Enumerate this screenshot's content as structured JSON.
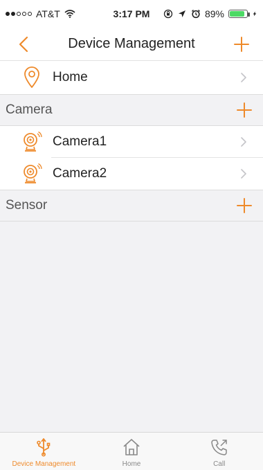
{
  "statusbar": {
    "carrier": "AT&T",
    "time": "3:17 PM",
    "battery": "89%",
    "battery_level": 0.89
  },
  "navbar": {
    "title": "Device Management"
  },
  "home_row": {
    "label": "Home",
    "icon": "location-pin-icon"
  },
  "sections": {
    "camera": {
      "label": "Camera",
      "items": [
        {
          "label": "Camera1",
          "icon": "camera-icon"
        },
        {
          "label": "Camera2",
          "icon": "camera-icon"
        }
      ]
    },
    "sensor": {
      "label": "Sensor"
    }
  },
  "tabbar": {
    "tabs": [
      {
        "label": "Device Management",
        "icon": "usb-icon",
        "active": true
      },
      {
        "label": "Home",
        "icon": "house-icon",
        "active": false
      },
      {
        "label": "Call",
        "icon": "phone-outgoing-icon",
        "active": false
      }
    ]
  },
  "colors": {
    "accent": "#ee8a2b",
    "inactive": "#888888",
    "background": "#f2f2f4"
  }
}
